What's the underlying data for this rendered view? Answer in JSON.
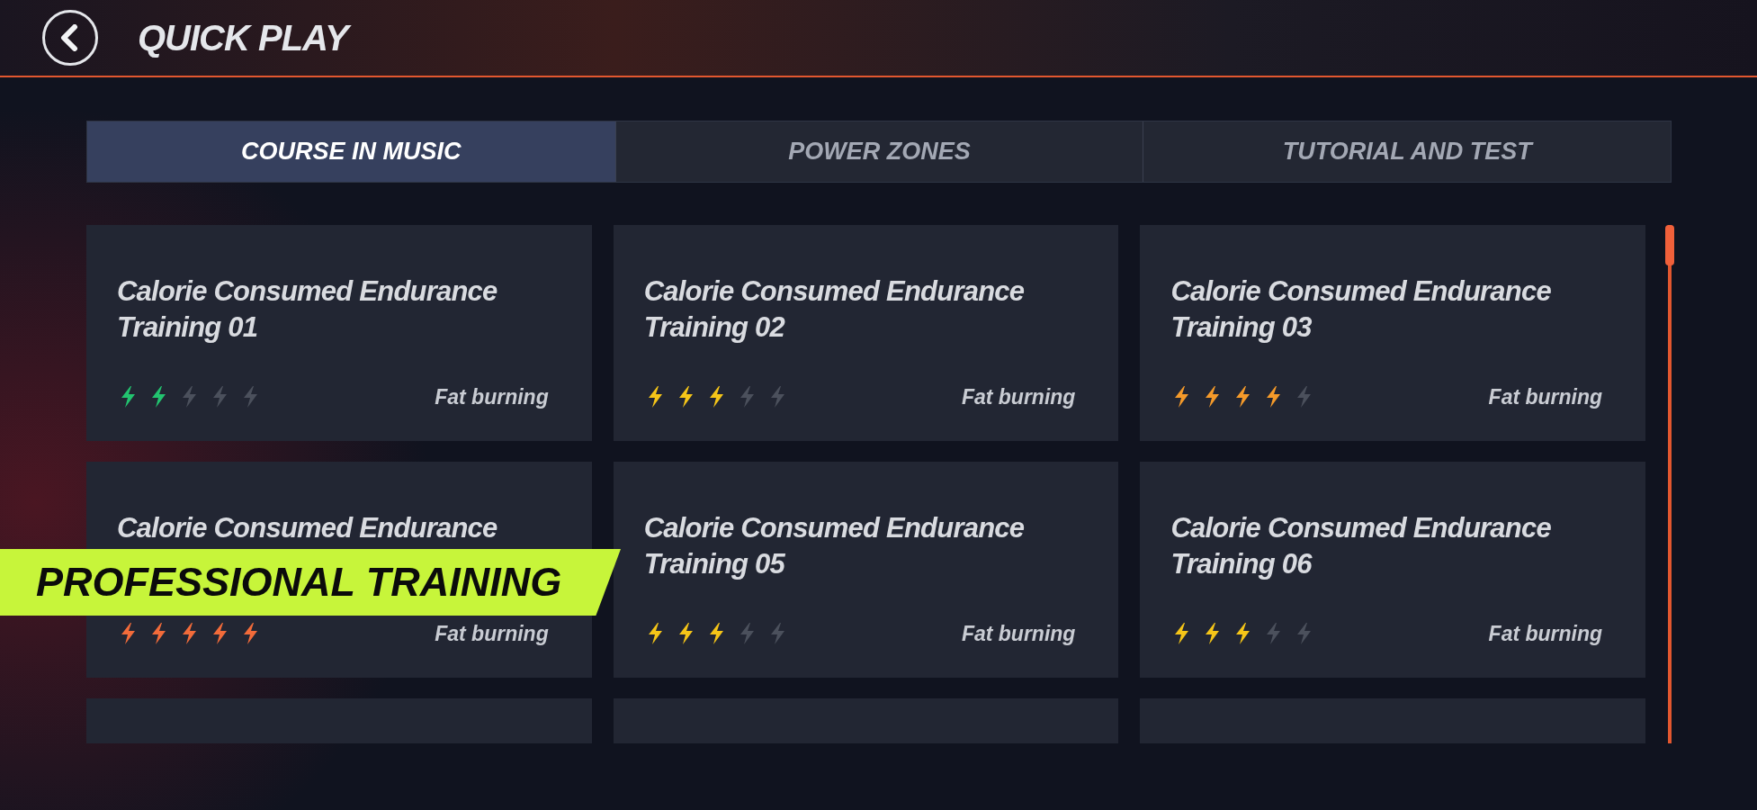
{
  "header": {
    "title": "QUICK PLAY"
  },
  "tabs": [
    {
      "label": "COURSE IN MUSIC",
      "selected": true
    },
    {
      "label": "POWER ZONES",
      "selected": false
    },
    {
      "label": "TUTORIAL AND TEST",
      "selected": false
    }
  ],
  "cards": [
    {
      "title": "Calorie Consumed Endurance Training 01",
      "stars": 2,
      "color": "#22c36f",
      "tag": "Fat burning"
    },
    {
      "title": "Calorie Consumed Endurance Training 02",
      "stars": 3,
      "color": "#f5c518",
      "tag": "Fat burning"
    },
    {
      "title": "Calorie Consumed Endurance Training 03",
      "stars": 4,
      "color": "#f59a2a",
      "tag": "Fat burning"
    },
    {
      "title": "Calorie Consumed Endurance",
      "stars": 5,
      "color": "#f26b3a",
      "tag": "Fat burning"
    },
    {
      "title": "Calorie Consumed Endurance Training 05",
      "stars": 3,
      "color": "#f5c518",
      "tag": "Fat burning"
    },
    {
      "title": "Calorie Consumed Endurance Training 06",
      "stars": 3,
      "color": "#f5c518",
      "tag": "Fat burning"
    }
  ],
  "banner": {
    "label": "PROFESSIONAL TRAINING"
  }
}
